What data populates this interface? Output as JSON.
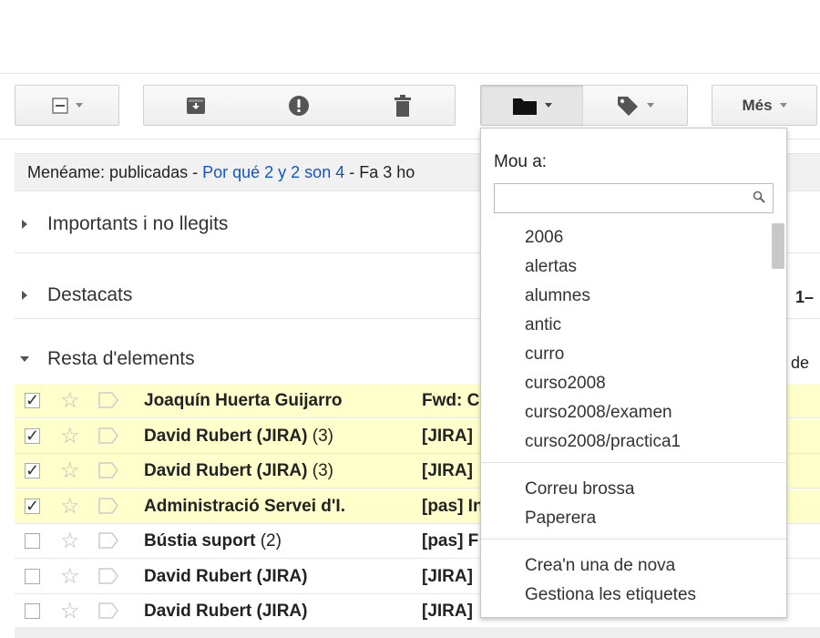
{
  "toolbar": {
    "more_label": "Més"
  },
  "banner": {
    "source": "Menéame: publicadas - ",
    "link": "Por qué 2 y 2 son 4",
    "rest": " - Fa 3 ho"
  },
  "sections": {
    "important": "Importants i no llegits",
    "starred": "Destacats",
    "rest": "Resta d'elements"
  },
  "side": {
    "range": "1–",
    "of": "de"
  },
  "rows": [
    {
      "checked": true,
      "sender": "Joaquín Huerta Guijarro",
      "count": "",
      "subject": "Fwd: C"
    },
    {
      "checked": true,
      "sender": "David Rubert (JIRA)",
      "count": " (3)",
      "subject": "[JIRA]"
    },
    {
      "checked": true,
      "sender": "David Rubert (JIRA)",
      "count": " (3)",
      "subject": "[JIRA]"
    },
    {
      "checked": true,
      "sender": "Administració Servei d'I.",
      "count": "",
      "subject": "[pas] In"
    },
    {
      "checked": false,
      "sender": "Bústia suport",
      "count": " (2)",
      "subject": "[pas] F"
    },
    {
      "checked": false,
      "sender": "David Rubert (JIRA)",
      "count": "",
      "subject": "[JIRA]"
    },
    {
      "checked": false,
      "sender": "David Rubert (JIRA)",
      "count": "",
      "subject": "[JIRA]"
    }
  ],
  "move_menu": {
    "title": "Mou a:",
    "search_value": "",
    "labels": [
      "2006",
      "alertas",
      "alumnes",
      "antic",
      "curro",
      "curso2008",
      "curso2008/examen",
      "curso2008/practica1"
    ],
    "system": [
      "Correu brossa",
      "Paperera"
    ],
    "actions": [
      "Crea'n una de nova",
      "Gestiona les etiquetes"
    ]
  },
  "icons": {
    "select": "select-checkbox-icon",
    "archive": "archive-icon",
    "spam": "report-spam-icon",
    "delete": "trash-icon",
    "move": "folder-icon",
    "labels": "label-tag-icon",
    "search": "search-icon",
    "star": "star-icon",
    "importance": "importance-marker-icon"
  },
  "colors": {
    "selected_row": "#ffffcc",
    "link": "#1155cc"
  }
}
